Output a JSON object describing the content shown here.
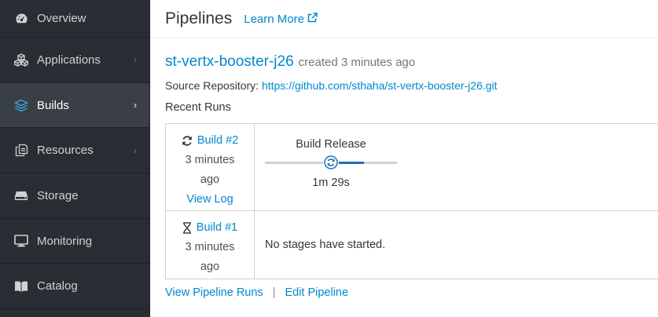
{
  "sidebar": {
    "items": [
      {
        "label": "Overview",
        "icon": "dashboard-icon",
        "active": false,
        "chevron": false
      },
      {
        "label": "Applications",
        "icon": "cubes-icon",
        "active": false,
        "chevron": true
      },
      {
        "label": "Builds",
        "icon": "layers-icon",
        "active": true,
        "chevron": true
      },
      {
        "label": "Resources",
        "icon": "files-icon",
        "active": false,
        "chevron": true
      },
      {
        "label": "Storage",
        "icon": "storage-icon",
        "active": false,
        "chevron": false
      },
      {
        "label": "Monitoring",
        "icon": "monitor-icon",
        "active": false,
        "chevron": false
      },
      {
        "label": "Catalog",
        "icon": "book-icon",
        "active": false,
        "chevron": false
      }
    ]
  },
  "header": {
    "title": "Pipelines",
    "learn_more": "Learn More"
  },
  "pipeline": {
    "name": "st-vertx-booster-j26",
    "created": "created",
    "created_ago": "3 minutes ago",
    "source_label": "Source Repository:",
    "source_url": "https://github.com/sthaha/st-vertx-booster-j26.git",
    "recent_runs_label": "Recent Runs"
  },
  "runs": [
    {
      "build": "Build #2",
      "time_line1": "3 minutes",
      "time_line2": "ago",
      "view_log": "View Log",
      "status_icon": "sync-icon",
      "stage_name": "Build Release",
      "stage_duration": "1m 29s"
    },
    {
      "build": "Build #1",
      "time_line1": "3 minutes",
      "time_line2": "ago",
      "status_icon": "hourglass-icon",
      "message": "No stages have started."
    }
  ],
  "footer": {
    "view_runs": "View Pipeline Runs",
    "separator": "|",
    "edit": "Edit Pipeline"
  },
  "colors": {
    "sidebar_bg": "#292e34",
    "sidebar_active": "#393f44",
    "link": "#0088ce",
    "progress": "#1f6fb8"
  }
}
